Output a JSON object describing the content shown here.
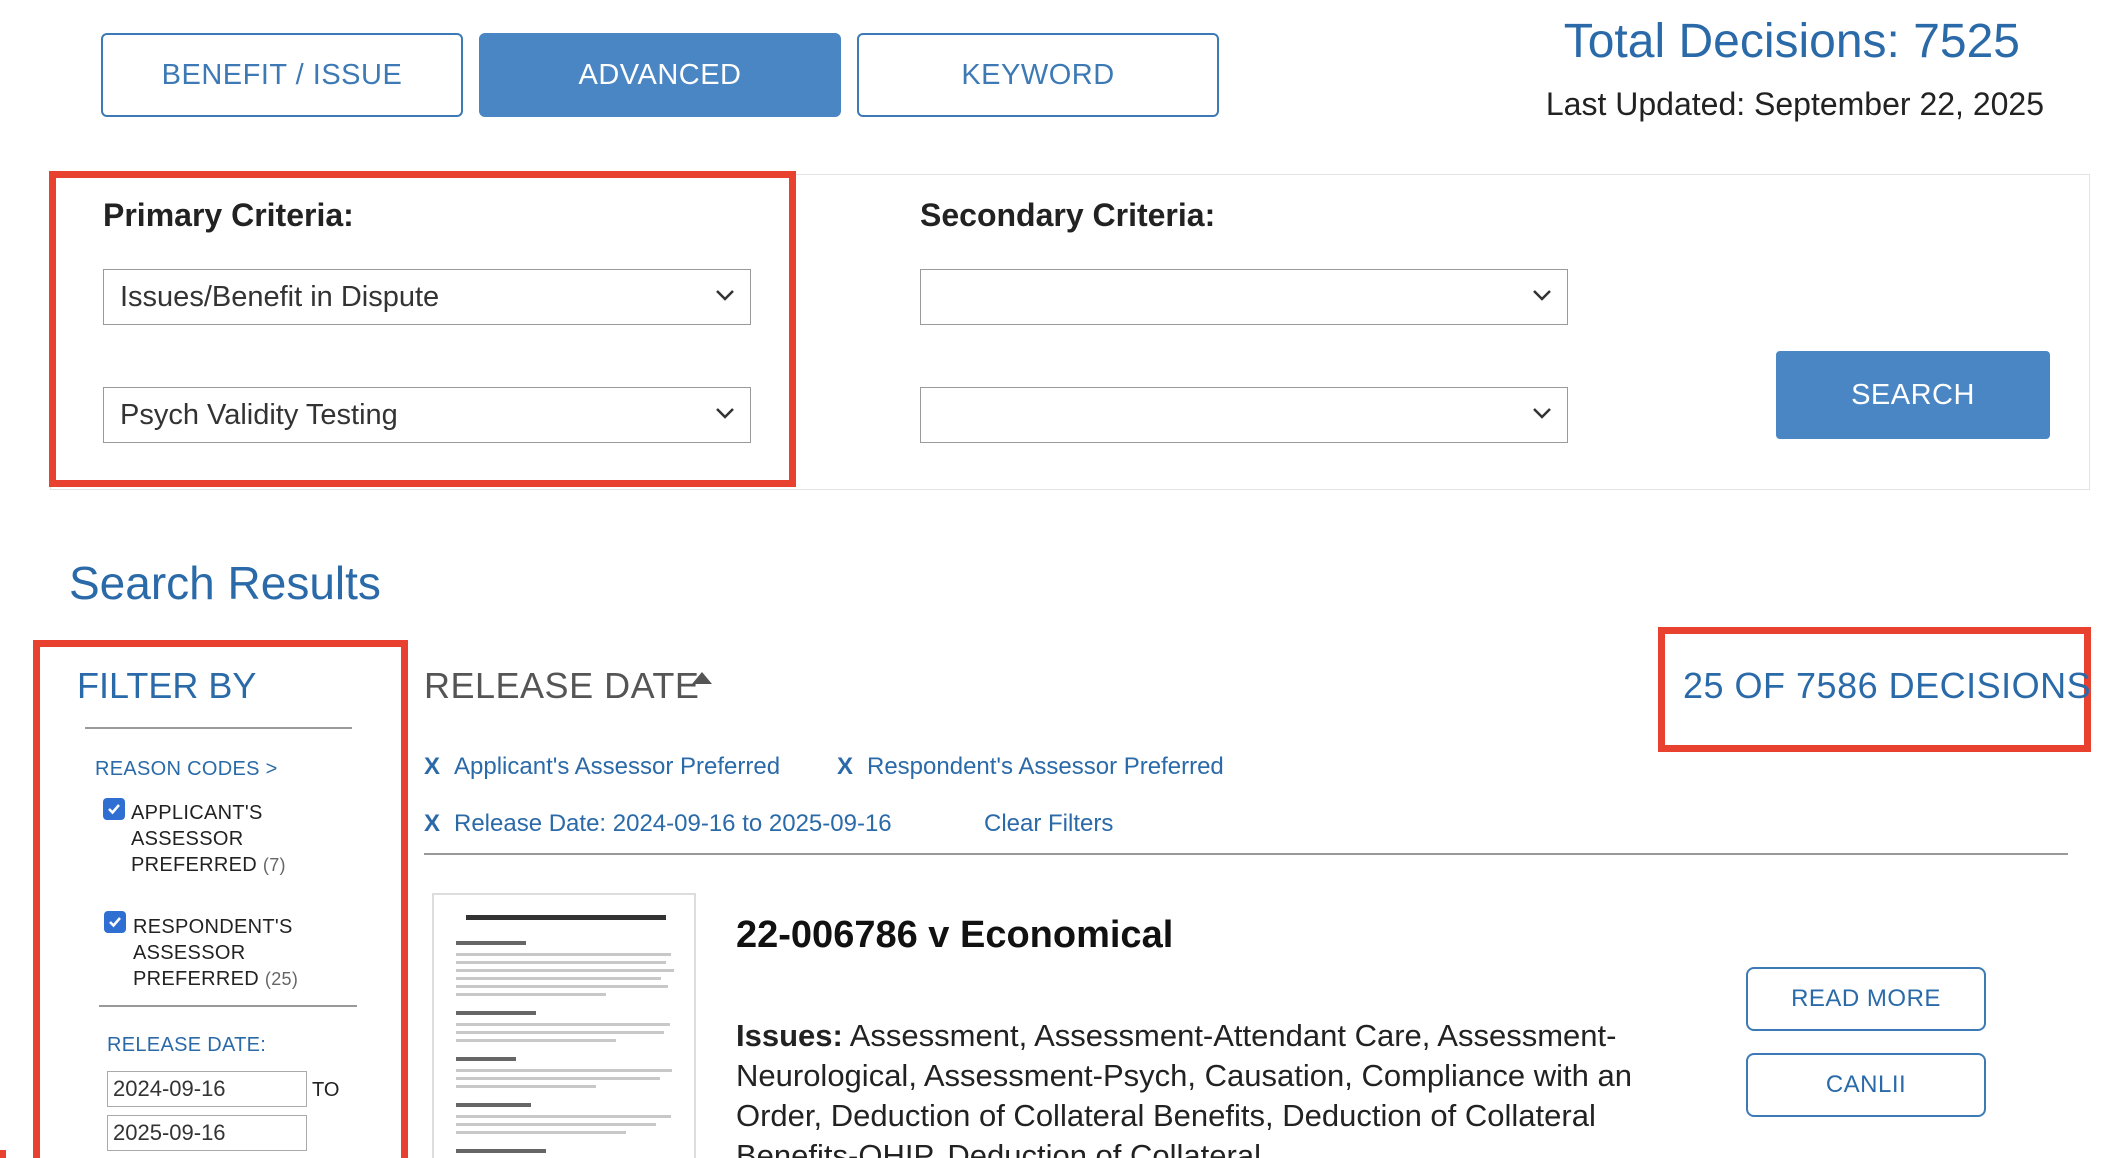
{
  "tabs": [
    {
      "label": "BENEFIT / ISSUE",
      "active": false
    },
    {
      "label": "ADVANCED",
      "active": true
    },
    {
      "label": "KEYWORD",
      "active": false
    }
  ],
  "header": {
    "total_decisions": "Total Decisions: 7525",
    "last_updated": "Last Updated: September 22, 2025"
  },
  "criteria": {
    "primary_label": "Primary Criteria:",
    "primary_select_1": "Issues/Benefit in Dispute",
    "primary_select_2": "Psych Validity Testing",
    "secondary_label": "Secondary Criteria:",
    "secondary_select_1": "",
    "secondary_select_2": "",
    "search_label": "SEARCH"
  },
  "results": {
    "title": "Search Results",
    "sort_label": "RELEASE DATE",
    "count_label": "25 OF 7586 DECISIONS",
    "active_filters": [
      "Applicant's Assessor Preferred",
      "Respondent's Assessor Preferred",
      "Release Date: 2024-09-16 to 2025-09-16"
    ],
    "clear_filters": "Clear Filters",
    "items": [
      {
        "title": "22-006786 v Economical",
        "issues_label": "Issues:",
        "issues_text": "Assessment, Assessment-Attendant Care, Assessment-Neurological, Assessment-Psych, Causation, Compliance with an Order, Deduction of Collateral Benefits, Deduction of Collateral Benefits-OHIP, Deduction of Collateral",
        "read_more": "READ MORE",
        "canlii": "CANLII"
      }
    ]
  },
  "filter": {
    "title": "FILTER BY",
    "reason_codes_label": "REASON CODES >",
    "options": [
      {
        "line1": "APPLICANT'S",
        "line2": "ASSESSOR",
        "line3": "PREFERRED",
        "count": "(7)",
        "checked": true
      },
      {
        "line1": "RESPONDENT'S",
        "line2": "ASSESSOR",
        "line3": "PREFERRED",
        "count": "(25)",
        "checked": true
      }
    ],
    "release_date_label": "RELEASE DATE:",
    "date_from": "2024-09-16",
    "to_label": "TO",
    "date_to": "2025-09-16"
  },
  "colors": {
    "accent": "#4a86c4",
    "link": "#2b6aa8",
    "highlight": "#e8412f"
  }
}
